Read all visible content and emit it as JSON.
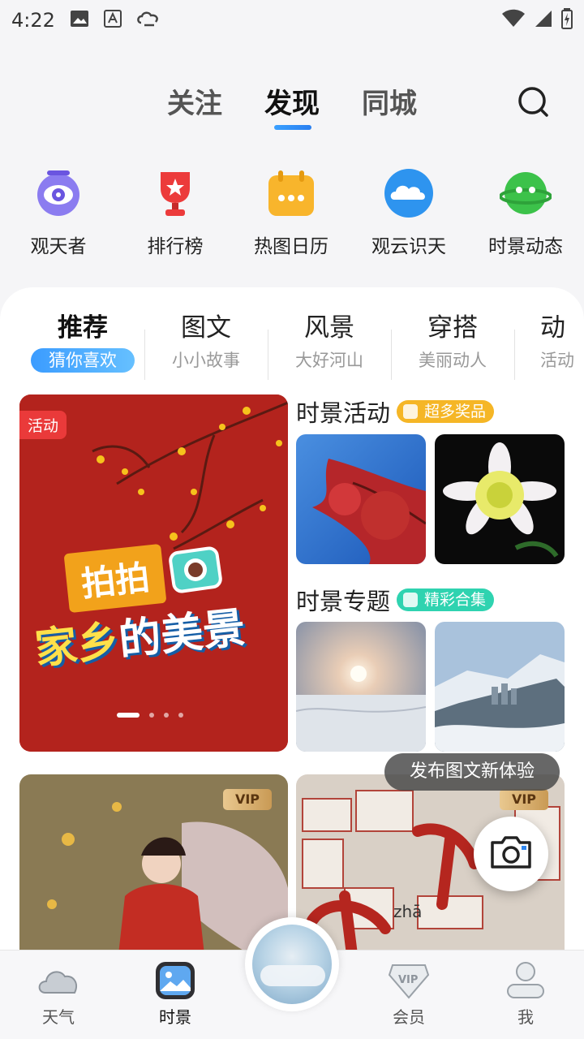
{
  "status_bar": {
    "time": "4:22"
  },
  "top_tabs": [
    {
      "label": "关注",
      "active": false
    },
    {
      "label": "发现",
      "active": true
    },
    {
      "label": "同城",
      "active": false
    }
  ],
  "quick_entries": [
    {
      "label": "观天者",
      "icon": "eye-icon",
      "color": "#7a63e8"
    },
    {
      "label": "排行榜",
      "icon": "trophy-icon",
      "color": "#e93a3a"
    },
    {
      "label": "热图日历",
      "icon": "calendar-icon",
      "color": "#f7b02a"
    },
    {
      "label": "观云识天",
      "icon": "cloud-icon",
      "color": "#2f95f0"
    },
    {
      "label": "时景动态",
      "icon": "planet-icon",
      "color": "#3cc24a"
    }
  ],
  "categories": [
    {
      "title": "推荐",
      "sub": "猜你喜欢",
      "active": true
    },
    {
      "title": "图文",
      "sub": "小小故事",
      "active": false
    },
    {
      "title": "风景",
      "sub": "大好河山",
      "active": false
    },
    {
      "title": "穿搭",
      "sub": "美丽动人",
      "active": false
    },
    {
      "title": "动",
      "sub": "活动",
      "active": false
    }
  ],
  "banner": {
    "badge": "活动",
    "line1": "拍拍",
    "line2_a": "家乡",
    "line2_b": "的美景"
  },
  "sections": {
    "activity": {
      "title": "时景活动",
      "pill": "超多奖品",
      "pill_color": "#f5b626"
    },
    "topic": {
      "title": "时景专题",
      "pill": "精彩合集",
      "pill_color": "#2fd3b0"
    }
  },
  "cards": [
    {
      "vip": "VIP"
    },
    {
      "vip": "VIP",
      "caption": "查"
    }
  ],
  "publish_tip": "发布图文新体验",
  "bottom_nav": [
    {
      "label": "天气",
      "icon": "cloud-nav-icon",
      "active": false
    },
    {
      "label": "时景",
      "icon": "picture-nav-icon",
      "active": true
    },
    {
      "label": "会员",
      "icon": "vip-nav-icon",
      "active": false
    },
    {
      "label": "我",
      "icon": "user-nav-icon",
      "active": false
    }
  ]
}
